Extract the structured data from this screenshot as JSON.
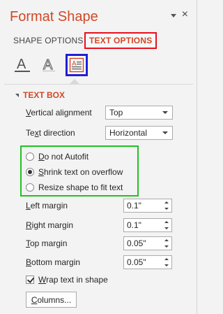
{
  "pane": {
    "title": "Format Shape",
    "options_icon": "chevron-down-icon",
    "close_label": "×"
  },
  "tabs": {
    "shape_options": "SHAPE OPTIONS",
    "text_options": "TEXT OPTIONS",
    "active": "text_options"
  },
  "icon_tabs": [
    {
      "name": "text-fill-outline-icon",
      "glyph": "A"
    },
    {
      "name": "text-effects-icon",
      "glyph": "A"
    },
    {
      "name": "textbox-icon",
      "selected": true
    }
  ],
  "section": {
    "title": "TEXT BOX",
    "expanded": true
  },
  "vertical_alignment": {
    "label_pre": "",
    "label_u": "V",
    "label_post": "ertical alignment",
    "value": "Top"
  },
  "text_direction": {
    "label_pre": "Te",
    "label_u": "x",
    "label_post": "t direction",
    "value": "Horizontal"
  },
  "autofit": {
    "options": [
      {
        "u": "D",
        "rest": "o not Autofit",
        "selected": false
      },
      {
        "u": "S",
        "rest": "hrink text on overflow",
        "selected": true
      },
      {
        "u": "",
        "rest": "Resize shape to fit text",
        "selected": false
      }
    ]
  },
  "margins": {
    "left": {
      "label_u": "L",
      "label_rest": "eft margin",
      "value": "0.1\""
    },
    "right": {
      "label_u": "R",
      "label_rest": "ight margin",
      "value": "0.1\""
    },
    "top": {
      "label_u": "T",
      "label_rest": "op margin",
      "value": "0.05\""
    },
    "bottom": {
      "label_u": "B",
      "label_rest": "ottom margin",
      "value": "0.05\""
    }
  },
  "wrap": {
    "label_u": "W",
    "label_rest": "rap text in shape",
    "checked": true
  },
  "columns_button": {
    "label_u": "C",
    "label_rest": "olumns..."
  },
  "colors": {
    "accent": "#d24726",
    "highlight_red": "#e8101e",
    "highlight_blue": "#1f1fd9",
    "highlight_green": "#22c122"
  }
}
